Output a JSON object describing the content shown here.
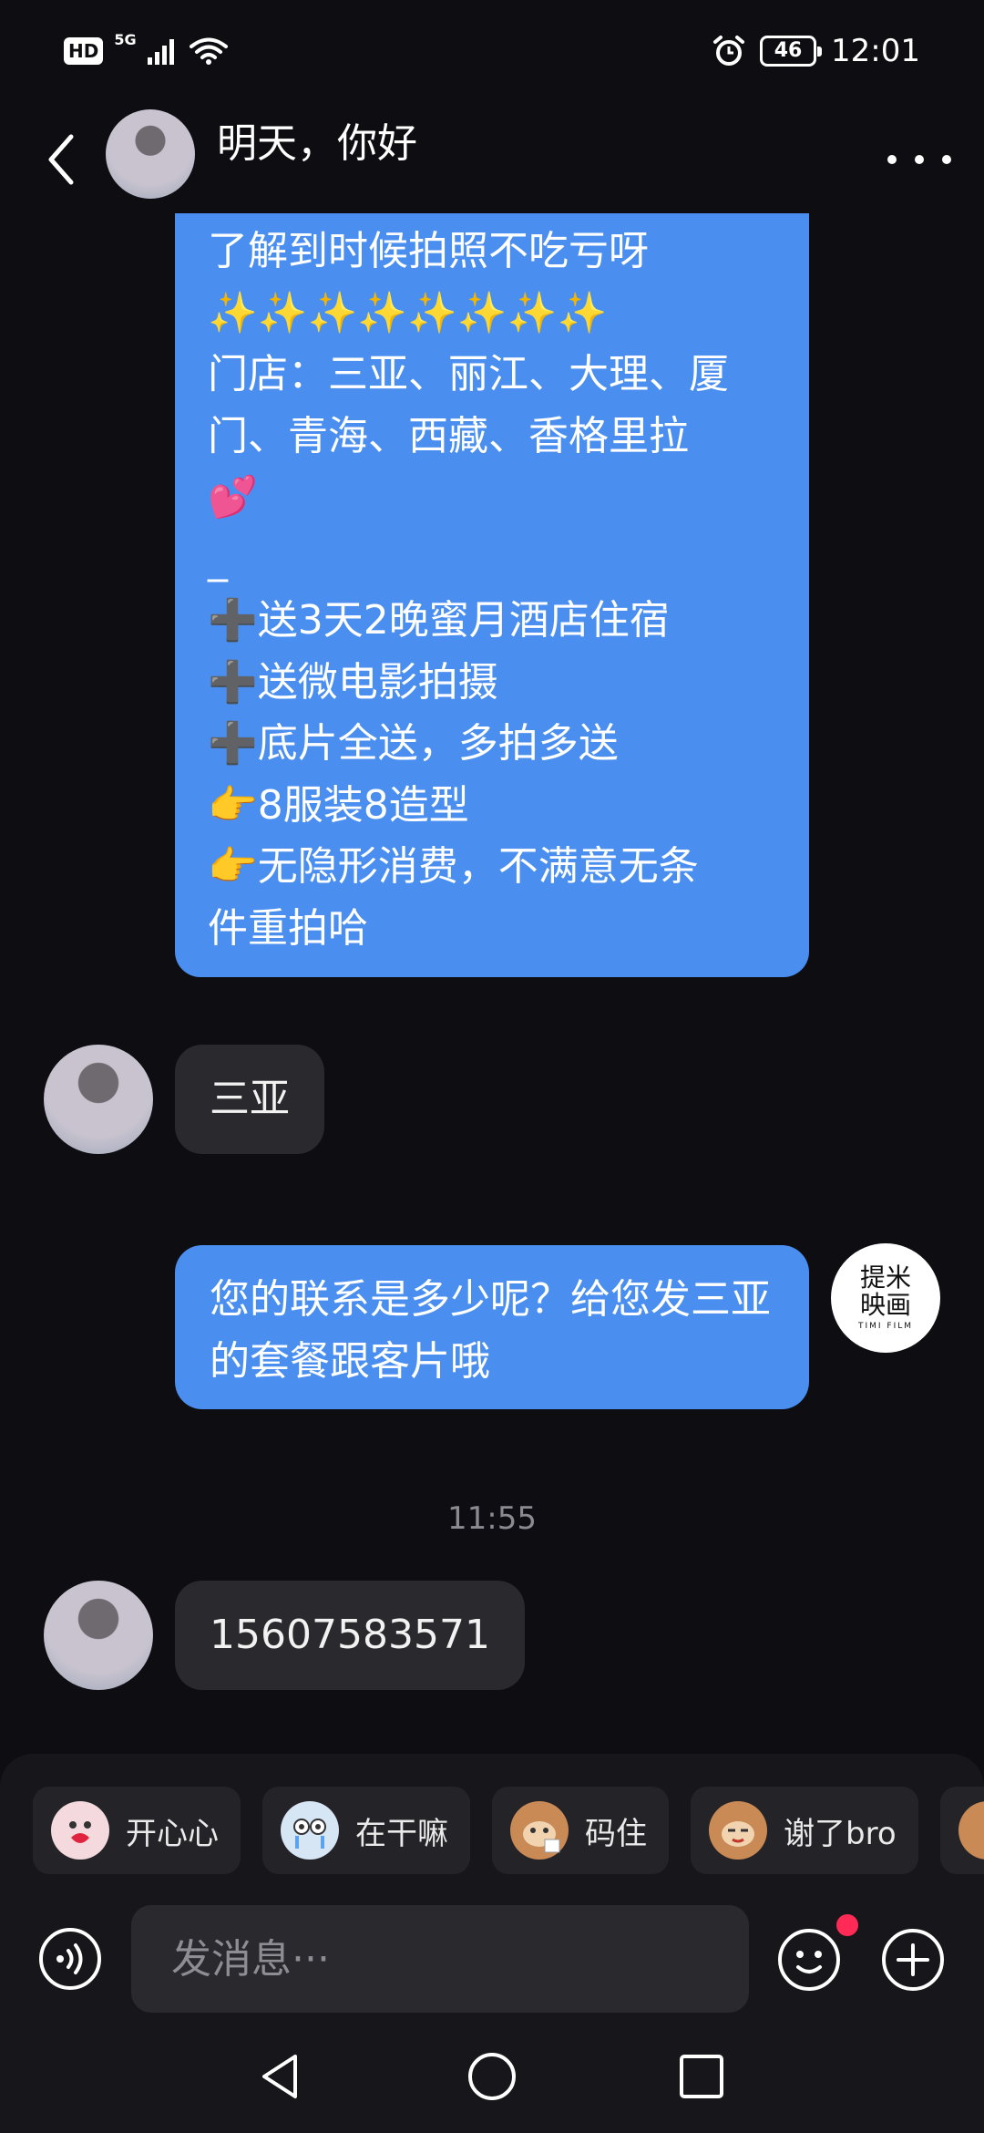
{
  "status_bar": {
    "hd": "HD",
    "network": "5G",
    "battery": "46",
    "time": "12:01"
  },
  "header": {
    "contact_name": "明天，你好"
  },
  "messages": {
    "promo_lines": [
      "了解到时候拍照不吃亏呀",
      "✨✨✨✨✨✨✨✨",
      "门店：三亚、丽江、大理、厦",
      "门、青海、西藏、香格里拉",
      "💕",
      "_",
      "➕送3天2晚蜜月酒店住宿",
      "➕送微电影拍摄",
      "➕底片全送，多拍多送",
      "👉8服装8造型",
      "👉无隐形消费，不满意无条",
      "件重拍哈"
    ],
    "reply_sanya": "三亚",
    "agent_reply": "您的联系是多少呢？给您发三亚的套餐跟客片哦",
    "timestamp": "11:55",
    "phone": "15607583571"
  },
  "brand_avatar": {
    "line1": "提米",
    "line2": "映画",
    "sub": "TIMI FILM"
  },
  "stickers": [
    {
      "label": "开心心",
      "icon": "heart-ghost-icon",
      "color": "#f4d9de"
    },
    {
      "label": "在干嘛",
      "icon": "crying-ghost-icon",
      "color": "#d7e6f4"
    },
    {
      "label": "码住",
      "icon": "monkey-note-icon",
      "color": "#c98a55"
    },
    {
      "label": "谢了bro",
      "icon": "monkey-thanks-icon",
      "color": "#c98a55"
    },
    {
      "label": "",
      "icon": "monkey-icon",
      "color": "#c98a55"
    }
  ],
  "composer": {
    "placeholder": "发消息···"
  },
  "colors": {
    "accent_blue": "#4a8ff0",
    "notification_red": "#ff2a55",
    "background": "#0e0e12"
  }
}
